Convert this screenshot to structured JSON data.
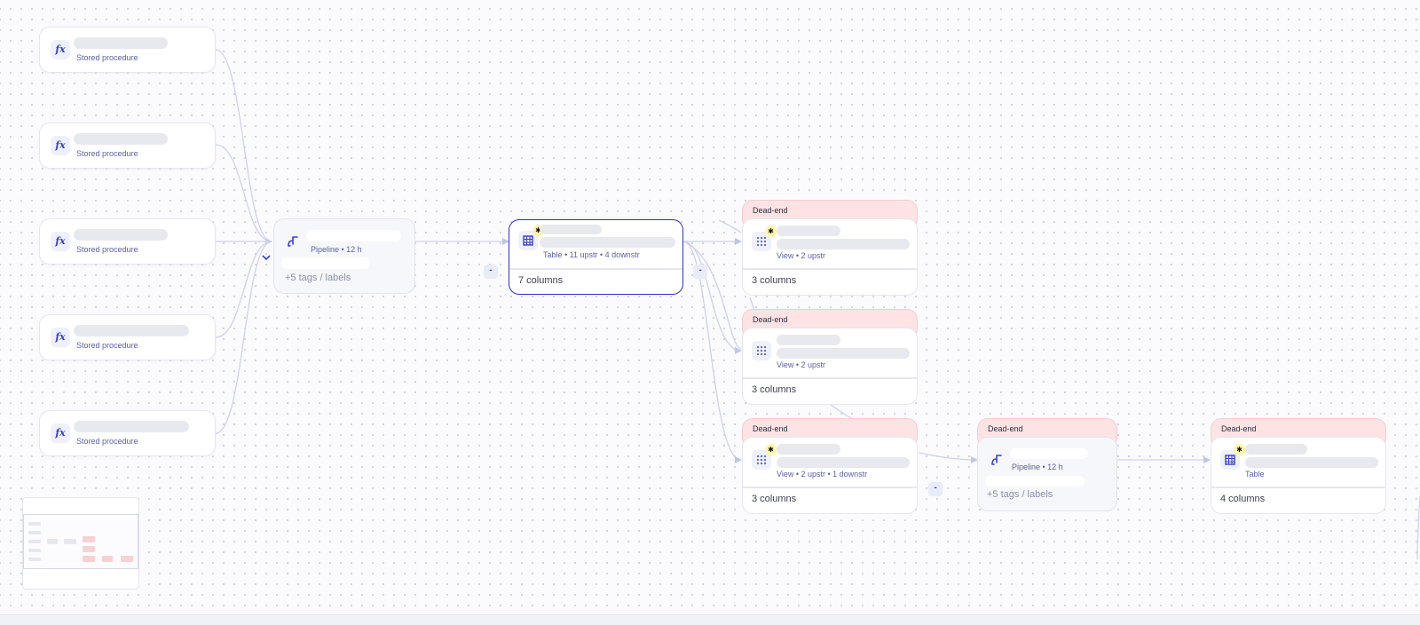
{
  "stored_procedures": [
    {
      "type_label": "Stored procedure"
    },
    {
      "type_label": "Stored procedure"
    },
    {
      "type_label": "Stored procedure"
    },
    {
      "type_label": "Stored procedure"
    },
    {
      "type_label": "Stored procedure"
    }
  ],
  "icons": {
    "function": "fx",
    "pipeline": "pipeline-icon",
    "table": "table-icon",
    "view": "view-icon",
    "badge": "bug-badge-icon"
  },
  "pipeline_main": {
    "meta": "Pipeline • 12 h",
    "tags": "+5 tags / labels"
  },
  "pipeline_right": {
    "meta": "Pipeline • 12 h",
    "tags": "+5 tags / labels"
  },
  "center_table": {
    "meta": "Table • 11 upstr • 4 downstr",
    "columns": "7 columns"
  },
  "dead_end_label": "Dead-end",
  "view_1": {
    "meta": "View • 2 upstr",
    "columns": "3 columns"
  },
  "view_2": {
    "meta": "View • 2 upstr",
    "columns": "3 columns"
  },
  "view_3": {
    "meta": "View • 2 upstr • 1 downstr",
    "columns": "3 columns"
  },
  "right_table": {
    "meta": "Table",
    "columns": "4 columns"
  },
  "collapse_label": "-",
  "colors": {
    "accent": "#3b3fc7",
    "edge": "#c7c9ea",
    "dead_end_bg": "#fde3e4",
    "selected_border": "#2f33c4"
  }
}
